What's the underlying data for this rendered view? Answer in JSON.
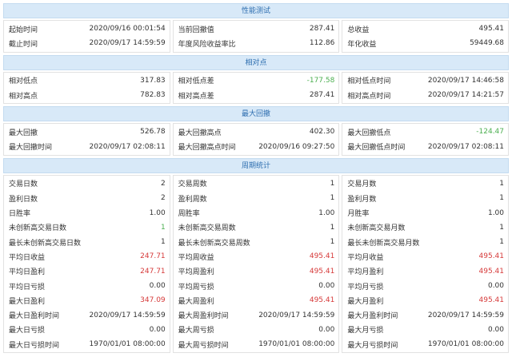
{
  "colors": {
    "header_bg": "#d8e9f8",
    "header_text": "#2f6fb0",
    "positive": "#d63a3a",
    "negative": "#4caf50"
  },
  "sections": [
    {
      "title": "性能测试",
      "columns": [
        [
          {
            "label": "起始时间",
            "value": "2020/09/16 00:01:54",
            "tone": ""
          },
          {
            "label": "截止时间",
            "value": "2020/09/17 14:59:59",
            "tone": ""
          }
        ],
        [
          {
            "label": "当前回撤值",
            "value": "287.41",
            "tone": ""
          },
          {
            "label": "年度风险收益率比",
            "value": "112.86",
            "tone": ""
          }
        ],
        [
          {
            "label": "总收益",
            "value": "495.41",
            "tone": ""
          },
          {
            "label": "年化收益",
            "value": "59449.68",
            "tone": ""
          }
        ]
      ]
    },
    {
      "title": "相对点",
      "columns": [
        [
          {
            "label": "相对低点",
            "value": "317.83",
            "tone": ""
          },
          {
            "label": "相对高点",
            "value": "782.83",
            "tone": ""
          }
        ],
        [
          {
            "label": "相对低点差",
            "value": "-177.58",
            "tone": "green"
          },
          {
            "label": "相对高点差",
            "value": "287.41",
            "tone": ""
          }
        ],
        [
          {
            "label": "相对低点时间",
            "value": "2020/09/17 14:46:58",
            "tone": ""
          },
          {
            "label": "相对高点时间",
            "value": "2020/09/17 14:21:57",
            "tone": ""
          }
        ]
      ]
    },
    {
      "title": "最大回撤",
      "columns": [
        [
          {
            "label": "最大回撤",
            "value": "526.78",
            "tone": ""
          },
          {
            "label": "最大回撤时间",
            "value": "2020/09/17 02:08:11",
            "tone": ""
          }
        ],
        [
          {
            "label": "最大回撤高点",
            "value": "402.30",
            "tone": ""
          },
          {
            "label": "最大回撤高点时间",
            "value": "2020/09/16 09:27:50",
            "tone": ""
          }
        ],
        [
          {
            "label": "最大回撤低点",
            "value": "-124.47",
            "tone": "green"
          },
          {
            "label": "最大回撤低点时间",
            "value": "2020/09/17 02:08:11",
            "tone": ""
          }
        ]
      ]
    },
    {
      "title": "周期统计",
      "columns": [
        [
          {
            "label": "交易日数",
            "value": "2",
            "tone": ""
          },
          {
            "label": "盈利日数",
            "value": "2",
            "tone": ""
          },
          {
            "label": "日胜率",
            "value": "1.00",
            "tone": ""
          },
          {
            "label": "未创新高交易日数",
            "value": "1",
            "tone": "green"
          },
          {
            "label": "最长未创新高交易日数",
            "value": "1",
            "tone": ""
          },
          {
            "label": "平均日收益",
            "value": "247.71",
            "tone": "red"
          },
          {
            "label": "平均日盈利",
            "value": "247.71",
            "tone": "red"
          },
          {
            "label": "平均日亏损",
            "value": "0.00",
            "tone": ""
          },
          {
            "label": "最大日盈利",
            "value": "347.09",
            "tone": "red"
          },
          {
            "label": "最大日盈利时间",
            "value": "2020/09/17 14:59:59",
            "tone": ""
          },
          {
            "label": "最大日亏损",
            "value": "0.00",
            "tone": ""
          },
          {
            "label": "最大日亏损时间",
            "value": "1970/01/01 08:00:00",
            "tone": ""
          }
        ],
        [
          {
            "label": "交易周数",
            "value": "1",
            "tone": ""
          },
          {
            "label": "盈利周数",
            "value": "1",
            "tone": ""
          },
          {
            "label": "周胜率",
            "value": "1.00",
            "tone": ""
          },
          {
            "label": "未创新高交易周数",
            "value": "1",
            "tone": ""
          },
          {
            "label": "最长未创新高交易周数",
            "value": "1",
            "tone": ""
          },
          {
            "label": "平均周收益",
            "value": "495.41",
            "tone": "red"
          },
          {
            "label": "平均周盈利",
            "value": "495.41",
            "tone": "red"
          },
          {
            "label": "平均周亏损",
            "value": "0.00",
            "tone": ""
          },
          {
            "label": "最大周盈利",
            "value": "495.41",
            "tone": "red"
          },
          {
            "label": "最大周盈利时间",
            "value": "2020/09/17 14:59:59",
            "tone": ""
          },
          {
            "label": "最大周亏损",
            "value": "0.00",
            "tone": ""
          },
          {
            "label": "最大周亏损时间",
            "value": "1970/01/01 08:00:00",
            "tone": ""
          }
        ],
        [
          {
            "label": "交易月数",
            "value": "1",
            "tone": ""
          },
          {
            "label": "盈利月数",
            "value": "1",
            "tone": ""
          },
          {
            "label": "月胜率",
            "value": "1.00",
            "tone": ""
          },
          {
            "label": "未创新高交易月数",
            "value": "1",
            "tone": ""
          },
          {
            "label": "最长未创新高交易月数",
            "value": "1",
            "tone": ""
          },
          {
            "label": "平均月收益",
            "value": "495.41",
            "tone": "red"
          },
          {
            "label": "平均月盈利",
            "value": "495.41",
            "tone": "red"
          },
          {
            "label": "平均月亏损",
            "value": "0.00",
            "tone": ""
          },
          {
            "label": "最大月盈利",
            "value": "495.41",
            "tone": "red"
          },
          {
            "label": "最大月盈利时间",
            "value": "2020/09/17 14:59:59",
            "tone": ""
          },
          {
            "label": "最大月亏损",
            "value": "0.00",
            "tone": ""
          },
          {
            "label": "最大月亏损时间",
            "value": "1970/01/01 08:00:00",
            "tone": ""
          }
        ]
      ]
    }
  ]
}
